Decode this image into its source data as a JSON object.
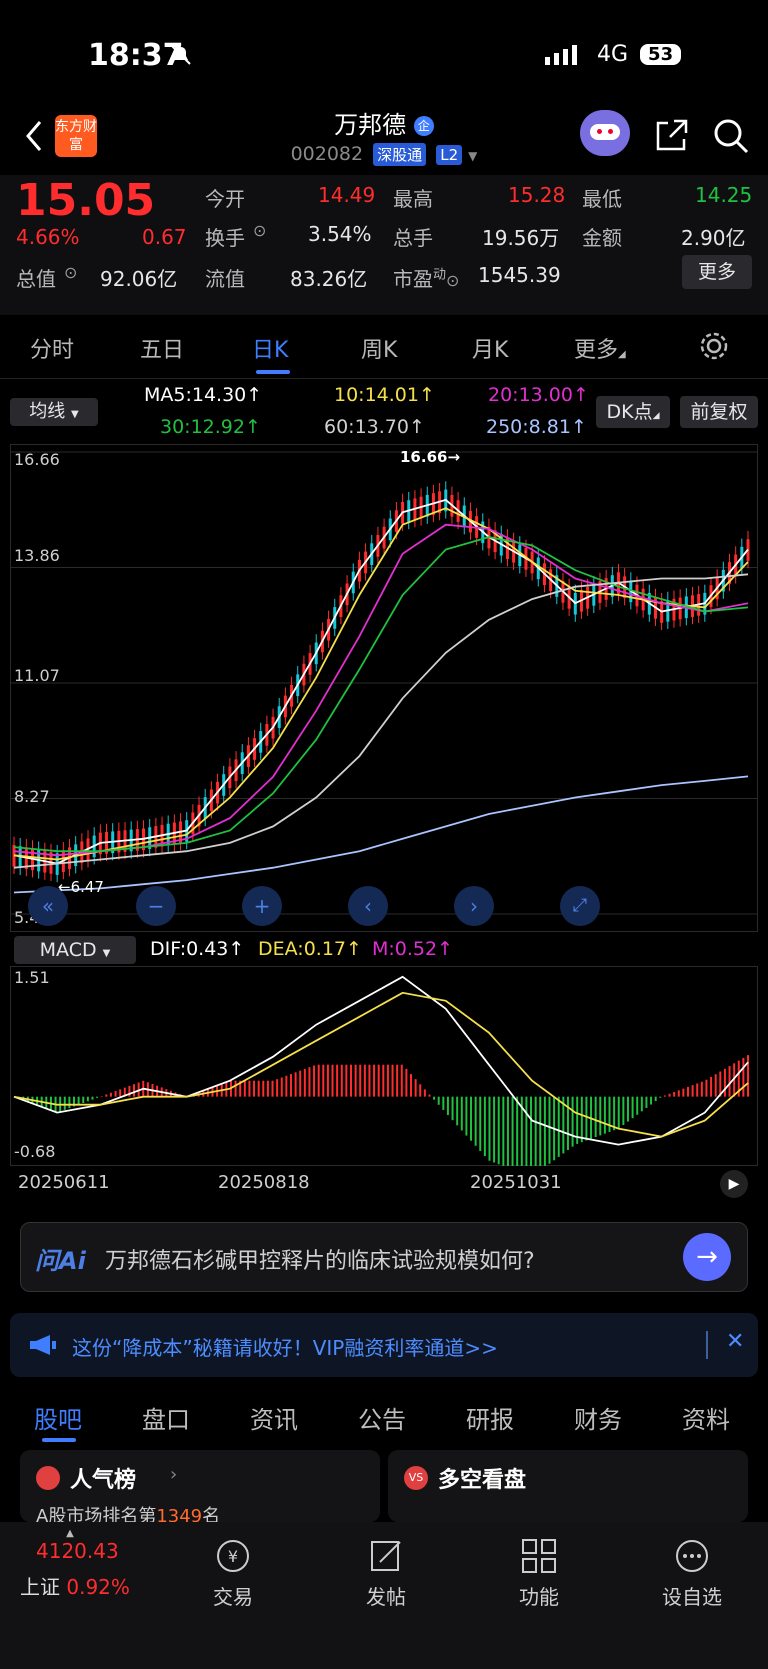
{
  "status": {
    "time": "18:37",
    "network": "4G",
    "battery": "53"
  },
  "header": {
    "app_logo": "东方财富",
    "stock_name": "万邦德",
    "enterprise_badge": "企",
    "code": "002082",
    "market": "深股通",
    "level": "L2"
  },
  "quote": {
    "price": "15.05",
    "pct": "4.66%",
    "change": "0.67",
    "open_label": "今开",
    "open": "14.49",
    "high_label": "最高",
    "high": "15.28",
    "low_label": "最低",
    "low": "14.25",
    "turnover_label": "换手",
    "turnover": "3.54%",
    "volume_label": "总手",
    "volume": "19.56万",
    "amount_label": "金额",
    "amount": "2.90亿",
    "mcap_label": "总值",
    "mcap": "92.06亿",
    "float_label": "流值",
    "float": "83.26亿",
    "pe_label": "市盈",
    "pe_sup": "动",
    "pe": "1545.39",
    "more_btn": "更多"
  },
  "tabs": [
    "分时",
    "五日",
    "日K",
    "周K",
    "月K",
    "更多"
  ],
  "ma": {
    "selector": "均线",
    "ma5": "MA5:14.30↑",
    "ma10": "10:14.01↑",
    "ma20": "20:13.00↑",
    "ma30": "30:12.92↑",
    "ma60": "60:13.70↑",
    "ma250": "250:8.81↑",
    "dk_btn": "DK点",
    "fq_btn": "前复权"
  },
  "chart_labels": {
    "y_top": "16.66",
    "y_2": "13.86",
    "y_3": "11.07",
    "y_4": "8.27",
    "y_bot": "5.48",
    "max_marker": "16.66→",
    "min_marker": "←6.47"
  },
  "macd": {
    "selector": "MACD",
    "dif": "DIF:0.43↑",
    "dea": "DEA:0.17↑",
    "m": "M:0.52↑",
    "y_top": "1.51",
    "y_bot": "-0.68"
  },
  "dates": [
    "20250611",
    "20250818",
    "20251031"
  ],
  "ai": {
    "logo": "问Ai",
    "question": "万邦德石杉碱甲控释片的临床试验规模如何?"
  },
  "ad": {
    "text": "这份“降成本”秘籍请收好！VIP融资利率通道>>"
  },
  "subtabs": [
    "股吧",
    "盘口",
    "资讯",
    "公告",
    "研报",
    "财务",
    "资料"
  ],
  "cards": {
    "left_title": "人气榜",
    "left_sub_prefix": "A股市场排名第",
    "left_sub_rank": "1349",
    "left_sub_suffix": "名",
    "right_title": "多空看盘"
  },
  "bottom": {
    "index_value": "4120.43",
    "index_name": "上证",
    "index_pct": "0.92%",
    "nav": [
      "交易",
      "发帖",
      "功能",
      "设自选"
    ]
  },
  "chart_data": {
    "type": "line",
    "title": "",
    "ylim": [
      5.48,
      16.66
    ],
    "x_ticks": [
      "20250611",
      "20250818",
      "20251031"
    ],
    "series": [
      {
        "name": "MA5",
        "values": [
          6.9,
          6.7,
          7.2,
          7.3,
          7.5,
          8.8,
          10.0,
          11.8,
          13.8,
          15.2,
          15.5,
          14.6,
          14.0,
          13.0,
          13.5,
          12.8,
          13.0,
          14.3
        ]
      },
      {
        "name": "MA10",
        "values": [
          6.9,
          6.8,
          7.0,
          7.2,
          7.4,
          8.3,
          9.5,
          11.2,
          13.2,
          14.9,
          15.3,
          14.8,
          14.0,
          13.3,
          13.2,
          13.0,
          12.9,
          14.0
        ]
      },
      {
        "name": "MA20",
        "values": [
          7.0,
          6.9,
          7.0,
          7.1,
          7.3,
          7.8,
          8.8,
          10.4,
          12.2,
          14.2,
          14.9,
          14.8,
          14.3,
          13.6,
          13.3,
          13.0,
          12.8,
          13.0
        ]
      },
      {
        "name": "MA30",
        "values": [
          7.1,
          7.0,
          7.0,
          7.1,
          7.2,
          7.5,
          8.4,
          9.7,
          11.4,
          13.2,
          14.3,
          14.6,
          14.4,
          13.8,
          13.4,
          13.1,
          12.8,
          12.9
        ]
      },
      {
        "name": "MA60",
        "values": [
          6.6,
          6.7,
          6.8,
          6.9,
          7.0,
          7.2,
          7.6,
          8.3,
          9.3,
          10.7,
          11.8,
          12.6,
          13.1,
          13.4,
          13.5,
          13.6,
          13.6,
          13.7
        ]
      },
      {
        "name": "MA250",
        "values": [
          6.0,
          6.05,
          6.1,
          6.2,
          6.3,
          6.45,
          6.6,
          6.8,
          7.0,
          7.3,
          7.6,
          7.9,
          8.1,
          8.3,
          8.45,
          8.6,
          8.7,
          8.81
        ]
      }
    ],
    "macd": {
      "dif": [
        0.0,
        -0.2,
        -0.1,
        0.1,
        0.0,
        0.2,
        0.5,
        0.9,
        1.2,
        1.5,
        1.1,
        0.4,
        -0.3,
        -0.5,
        -0.6,
        -0.5,
        -0.2,
        0.43
      ],
      "dea": [
        0.0,
        -0.1,
        -0.1,
        0.0,
        0.0,
        0.1,
        0.4,
        0.7,
        1.0,
        1.3,
        1.2,
        0.8,
        0.2,
        -0.2,
        -0.4,
        -0.5,
        -0.3,
        0.17
      ]
    }
  },
  "colors": {
    "up": "#ff2d2d",
    "down": "#20c040",
    "accent": "#3f7eff",
    "ma5": "#ffffff",
    "ma10": "#f5e04a",
    "ma20": "#e030d0",
    "ma30": "#20c040",
    "ma60": "#cfcfcf",
    "ma250": "#a9c4ff"
  }
}
